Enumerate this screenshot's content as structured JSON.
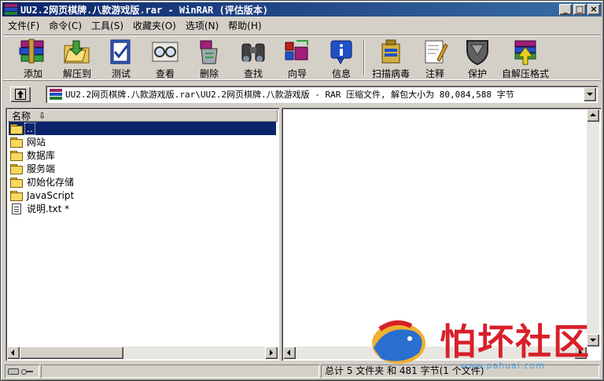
{
  "window": {
    "title": "UU2.2网页棋牌.八款游戏版.rar - WinRAR (评估版本)",
    "min_label": "_",
    "max_label": "□",
    "close_label": "×"
  },
  "menu": [
    {
      "label": "文件(F)"
    },
    {
      "label": "命令(C)"
    },
    {
      "label": "工具(S)"
    },
    {
      "label": "收藏夹(O)"
    },
    {
      "label": "选项(N)"
    },
    {
      "label": "帮助(H)"
    }
  ],
  "toolbar": [
    {
      "label": "添加",
      "icon": "add-books-icon"
    },
    {
      "label": "解压到",
      "icon": "extract-folder-icon"
    },
    {
      "label": "测试",
      "icon": "test-check-icon"
    },
    {
      "label": "查看",
      "icon": "view-glasses-icon"
    },
    {
      "label": "删除",
      "icon": "delete-recycle-icon"
    },
    {
      "label": "查找",
      "icon": "find-binoculars-icon"
    },
    {
      "label": "向导",
      "icon": "wizard-icon"
    },
    {
      "label": "信息",
      "icon": "info-icon"
    },
    {
      "label": "扫描病毒",
      "icon": "virus-scan-icon"
    },
    {
      "label": "注释",
      "icon": "comment-icon"
    },
    {
      "label": "保护",
      "icon": "protect-shield-icon"
    },
    {
      "label": "自解压格式",
      "icon": "sfx-icon"
    }
  ],
  "address": {
    "path": "UU2.2网页棋牌.八款游戏版.rar\\UU2.2网页棋牌.八款游戏版 - RAR 压缩文件, 解包大小为 80,084,588 字节"
  },
  "file_list": {
    "column_name": "名称",
    "sort_indicator": "⇩",
    "rows": [
      {
        "name": "..",
        "type": "folder",
        "selected": true
      },
      {
        "name": "网站",
        "type": "folder"
      },
      {
        "name": "数据库",
        "type": "folder"
      },
      {
        "name": "服务端",
        "type": "folder"
      },
      {
        "name": "初始化存储",
        "type": "folder"
      },
      {
        "name": "JavaScript",
        "type": "folder"
      },
      {
        "name": "说明.txt *",
        "type": "file"
      }
    ]
  },
  "status": {
    "left": "",
    "right": "总计 5 文件夹 和 481 字节(1 个文件)"
  },
  "watermark": {
    "text": "怕坏社区",
    "url": "www.pahuai.com"
  }
}
